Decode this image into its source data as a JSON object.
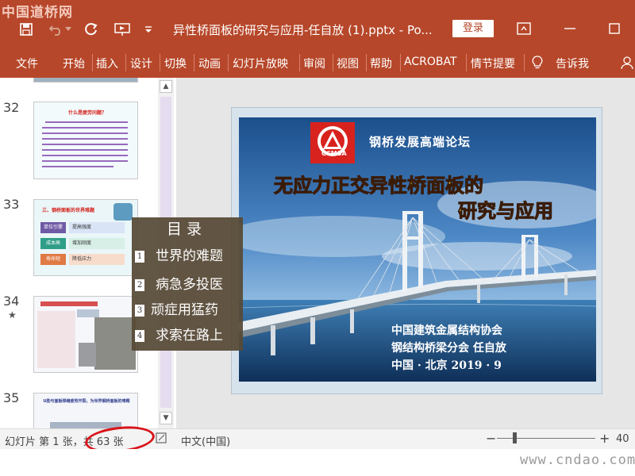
{
  "watermark_top": "中国道桥网",
  "window": {
    "title": "异性桥面板的研究与应用-任自放 (1).pptx  -  Po...",
    "login_label": "登录"
  },
  "ribbon": {
    "tabs": [
      "文件",
      "开始",
      "插入",
      "设计",
      "切换",
      "动画",
      "幻灯片放映",
      "审阅",
      "视图",
      "帮助",
      "ACROBAT",
      "情节提要",
      "告诉我"
    ]
  },
  "thumbnails": {
    "slide_numbers": [
      "32",
      "33",
      "34",
      "35"
    ],
    "thumb32_heading": "什么是疲劳问题？",
    "thumb33_heading": "三、钢桥面板的世界难题",
    "thumb33_rows": [
      {
        "left": "单位引擎",
        "right": "提高强度"
      },
      {
        "left": "成本高",
        "right": "增加刚度"
      },
      {
        "left": "寿命短",
        "right": "降低应力"
      }
    ],
    "thumb35_heading": "U肋与面板焊缝疲劳开裂，为世界钢桥面板的难题"
  },
  "slide": {
    "logo_text": "CCMSA",
    "forum_title": "钢桥发展高端论坛",
    "title_red": "无应力",
    "title_yellow": "正交异性桥面板的",
    "subtitle": "研究与应用",
    "org_line1": "中国建筑金属结构协会",
    "org_line2": "钢结构桥梁分会  任自放",
    "org_line3": "中国  · 北京       2019 · 9"
  },
  "toc": {
    "heading": "目录",
    "items": [
      {
        "num": "1",
        "text": "世界的难题"
      },
      {
        "num": "2",
        "text": "病急多投医"
      },
      {
        "num": "3",
        "text": "顽症用猛药"
      },
      {
        "num": "4",
        "text": "求索在路上"
      }
    ]
  },
  "status": {
    "slide_info": "幻灯片 第 1 张，共 63 张",
    "language": "中文(中国)",
    "zoom_minus": "−",
    "zoom_plus": "+",
    "zoom_value": "40"
  },
  "watermark_bottom": "www.cndao.com",
  "colors": {
    "ribbon": "#b7472a",
    "highlight_ellipse": "#d9141a",
    "toc_background": "#574a36"
  }
}
